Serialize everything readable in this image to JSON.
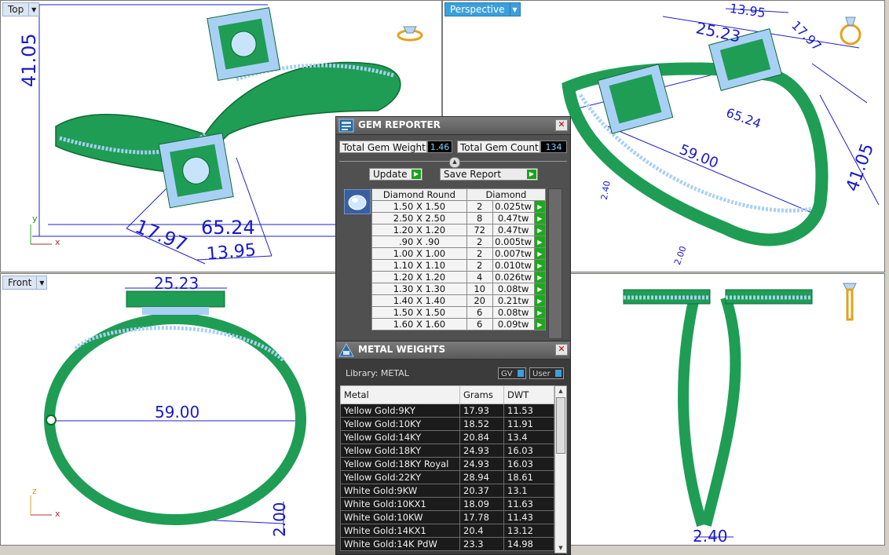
{
  "viewports": {
    "top": {
      "label": "Top",
      "dims": {
        "height": "41.05",
        "width": "65.24",
        "diag1": "17.97",
        "diag2": "13.95"
      }
    },
    "perspective": {
      "label": "Perspective",
      "dims": {
        "d1": "13.95",
        "d2": "25.23",
        "d3": "17.97",
        "d4": "65.24",
        "d5": "59.00",
        "d6": "41.05",
        "d7": "2.40",
        "d8": "2.00"
      }
    },
    "front": {
      "label": "Front",
      "dims": {
        "top": "25.23",
        "width": "59.00",
        "thick": "2.00"
      }
    },
    "right": {
      "dims": {
        "bottom": "2.40"
      }
    }
  },
  "axes": {
    "x": "x",
    "y": "y",
    "z": "z"
  },
  "gem_reporter": {
    "title": "GEM REPORTER",
    "total_weight_label": "Total Gem Weight",
    "total_weight_value": "1.46",
    "total_count_label": "Total Gem Count",
    "total_count_value": "134",
    "update_label": "Update",
    "save_label": "Save Report",
    "col_shape": "Diamond Round",
    "col_type": "Diamond",
    "rows": [
      {
        "size": "1.50 X 1.50",
        "count": "2",
        "tw": "0.025tw"
      },
      {
        "size": "2.50 X 2.50",
        "count": "8",
        "tw": "0.47tw"
      },
      {
        "size": "1.20 X 1.20",
        "count": "72",
        "tw": "0.47tw"
      },
      {
        "size": ".90 X .90",
        "count": "2",
        "tw": "0.005tw"
      },
      {
        "size": "1.00 X 1.00",
        "count": "2",
        "tw": "0.007tw"
      },
      {
        "size": "1.10 X 1.10",
        "count": "2",
        "tw": "0.010tw"
      },
      {
        "size": "1.20 X 1.20",
        "count": "4",
        "tw": "0.026tw"
      },
      {
        "size": "1.30 X 1.30",
        "count": "10",
        "tw": "0.08tw"
      },
      {
        "size": "1.40 X 1.40",
        "count": "20",
        "tw": "0.21tw"
      },
      {
        "size": "1.50 X 1.50",
        "count": "6",
        "tw": "0.08tw"
      },
      {
        "size": "1.60 X 1.60",
        "count": "6",
        "tw": "0.09tw"
      }
    ]
  },
  "metal_weights": {
    "title": "METAL WEIGHTS",
    "library": "Library: METAL",
    "gv_label": "GV",
    "user_label": "User",
    "col_metal": "Metal",
    "col_grams": "Grams",
    "col_dwt": "DWT",
    "rows": [
      {
        "metal": "Yellow Gold:9KY",
        "grams": "17.93",
        "dwt": "11.53"
      },
      {
        "metal": "Yellow Gold:10KY",
        "grams": "18.52",
        "dwt": "11.91"
      },
      {
        "metal": "Yellow Gold:14KY",
        "grams": "20.84",
        "dwt": "13.4"
      },
      {
        "metal": "Yellow Gold:18KY",
        "grams": "24.93",
        "dwt": "16.03"
      },
      {
        "metal": "Yellow Gold:18KY Royal",
        "grams": "24.93",
        "dwt": "16.03"
      },
      {
        "metal": "Yellow Gold:22KY",
        "grams": "28.94",
        "dwt": "18.61"
      },
      {
        "metal": "White Gold:9KW",
        "grams": "20.37",
        "dwt": "13.1"
      },
      {
        "metal": "White Gold:10KX1",
        "grams": "18.09",
        "dwt": "11.63"
      },
      {
        "metal": "White Gold:10KW",
        "grams": "17.78",
        "dwt": "11.43"
      },
      {
        "metal": "White Gold:14KX1",
        "grams": "20.4",
        "dwt": "13.12"
      },
      {
        "metal": "White Gold:14K PdW",
        "grams": "23.3",
        "dwt": "14.98"
      }
    ]
  },
  "colors": {
    "metal": "#1f9d55",
    "gems": "#9fc8f0",
    "dims": "#2020c8",
    "accent": "#3aa0dc"
  }
}
